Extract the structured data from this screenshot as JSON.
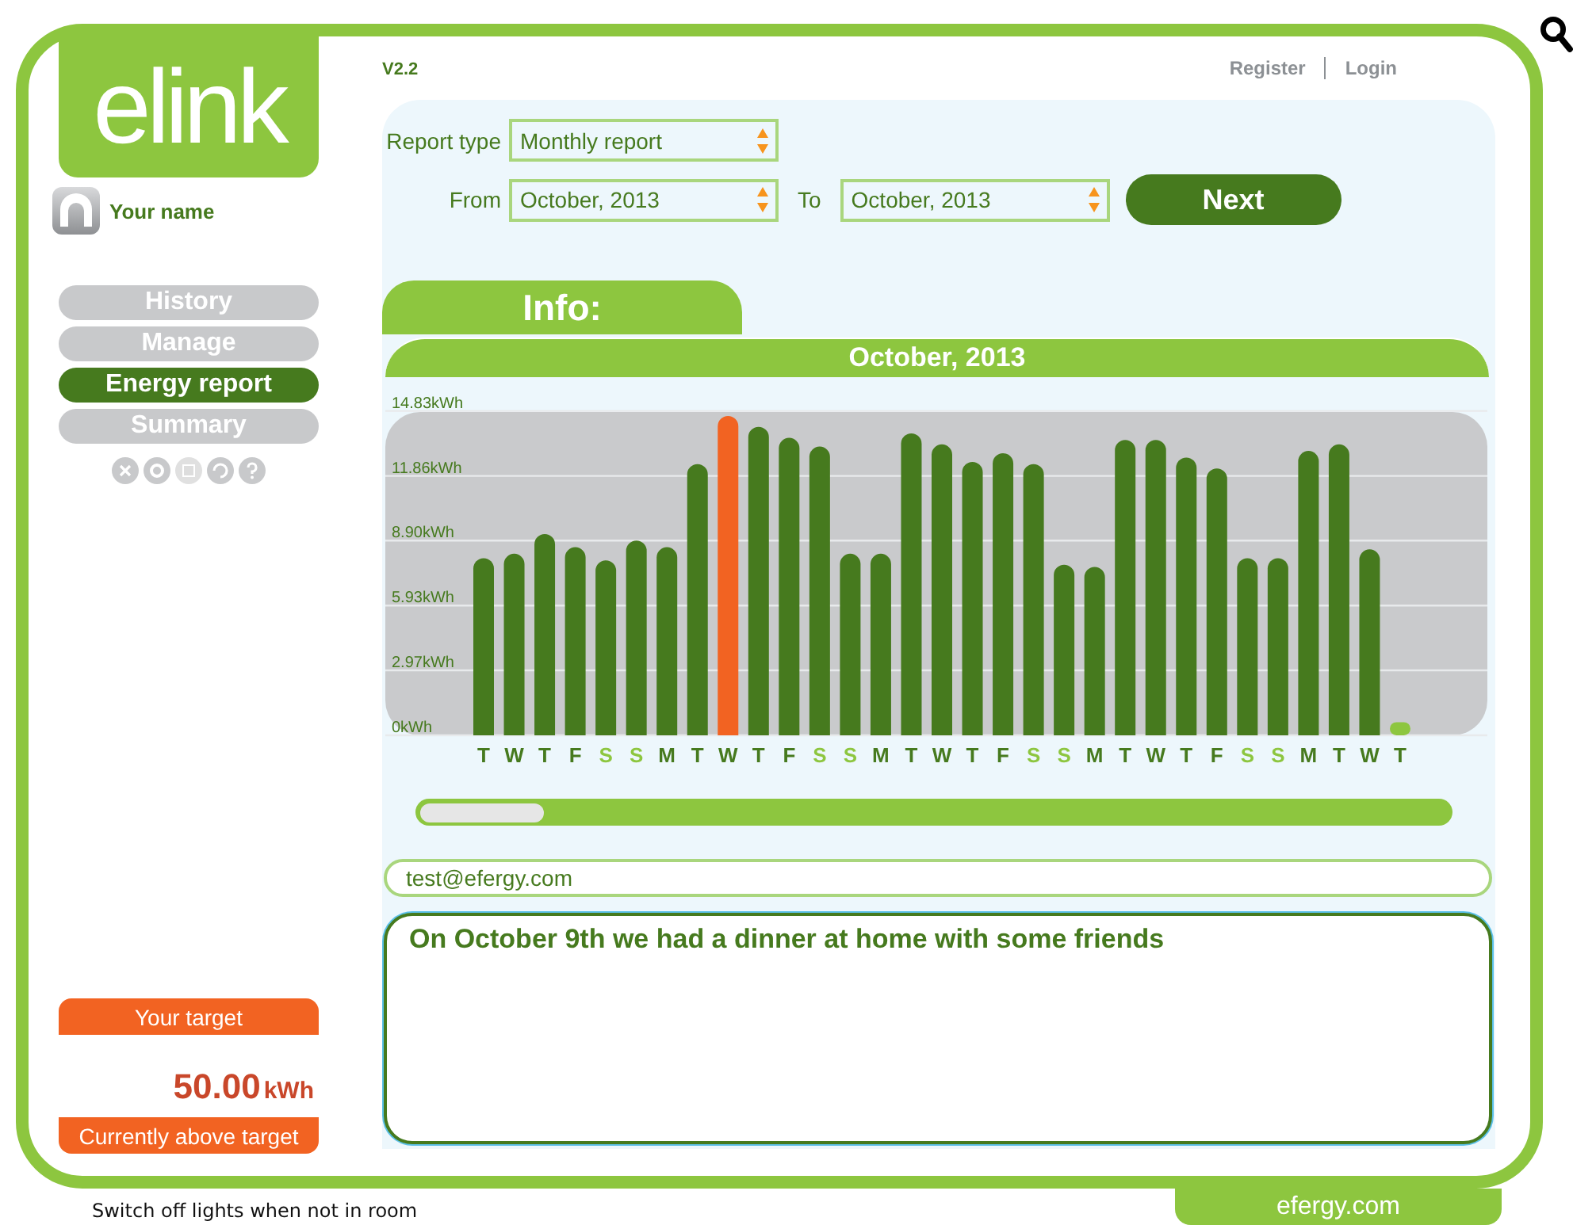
{
  "logo": {
    "text": "elink"
  },
  "user": {
    "name": "Your name"
  },
  "nav": [
    {
      "label": "History",
      "selected": false
    },
    {
      "label": "Manage",
      "selected": false
    },
    {
      "label": "Energy report",
      "selected": true
    },
    {
      "label": "Summary",
      "selected": false
    }
  ],
  "target": {
    "title": "Your target",
    "value": "50.00",
    "unit": "kWh",
    "status": "Currently above target"
  },
  "header": {
    "version": "V2.2",
    "links": [
      "Register",
      "Login"
    ]
  },
  "report_form": {
    "report_type": {
      "label": "Report type",
      "value": "Monthly report"
    },
    "from": {
      "label": "From",
      "value": "October, 2013"
    },
    "to": {
      "label": "To",
      "value": "October, 2013"
    },
    "next_button": "Next"
  },
  "info": {
    "tab": "Info:",
    "period": "October, 2013",
    "chart_data": {
      "type": "bar",
      "categories": [
        "T",
        "W",
        "T",
        "F",
        "S",
        "S",
        "M",
        "T",
        "W",
        "T",
        "F",
        "S",
        "S",
        "M",
        "T",
        "W",
        "T",
        "F",
        "S",
        "S",
        "M",
        "T",
        "W",
        "T",
        "F",
        "S",
        "S",
        "M",
        "T",
        "W",
        "T"
      ],
      "series": [
        {
          "color": "#467a1e",
          "values": [
            8.1,
            8.3,
            9.2,
            8.6,
            8.0,
            8.9,
            8.6,
            12.4,
            null,
            14.1,
            13.6,
            13.2,
            8.3,
            8.3,
            13.8,
            13.3,
            12.5,
            12.9,
            12.4,
            7.8,
            7.7,
            13.5,
            13.5,
            12.7,
            12.2,
            8.1,
            8.1,
            13.0,
            13.3,
            8.5,
            null
          ]
        },
        {
          "color": "#f26322",
          "values": [
            null,
            null,
            null,
            null,
            null,
            null,
            null,
            null,
            14.6,
            null,
            null,
            null,
            null,
            null,
            null,
            null,
            null,
            null,
            null,
            null,
            null,
            null,
            null,
            null,
            null,
            null,
            null,
            null,
            null,
            null,
            null
          ]
        },
        {
          "color": "#8dc63f",
          "values": [
            null,
            null,
            null,
            null,
            null,
            null,
            null,
            null,
            null,
            null,
            null,
            null,
            null,
            null,
            null,
            null,
            null,
            null,
            null,
            null,
            null,
            null,
            null,
            null,
            null,
            null,
            null,
            null,
            null,
            null,
            0.6
          ]
        }
      ],
      "ylim": [
        0,
        14.83
      ],
      "grid": true,
      "yticks": [
        {
          "value": 0,
          "label": "0kWh"
        },
        {
          "value": 2.97,
          "label": "2.97kWh"
        },
        {
          "value": 5.93,
          "label": "5.93kWh"
        },
        {
          "value": 8.9,
          "label": "8.90kWh"
        },
        {
          "value": 11.86,
          "label": "11.86kWh"
        },
        {
          "value": 14.83,
          "label": "14.83kWh"
        }
      ]
    },
    "days": [
      {
        "weekend": false
      },
      {
        "weekend": false
      },
      {
        "weekend": false
      },
      {
        "weekend": false
      },
      {
        "weekend": true
      },
      {
        "weekend": true
      },
      {
        "weekend": false
      },
      {
        "weekend": false
      },
      {
        "weekend": false
      },
      {
        "weekend": false
      },
      {
        "weekend": false
      },
      {
        "weekend": true
      },
      {
        "weekend": true
      },
      {
        "weekend": false
      },
      {
        "weekend": false
      },
      {
        "weekend": false
      },
      {
        "weekend": false
      },
      {
        "weekend": false
      },
      {
        "weekend": true
      },
      {
        "weekend": true
      },
      {
        "weekend": false
      },
      {
        "weekend": false
      },
      {
        "weekend": false
      },
      {
        "weekend": false
      },
      {
        "weekend": false
      },
      {
        "weekend": true
      },
      {
        "weekend": true
      },
      {
        "weekend": false
      },
      {
        "weekend": false
      },
      {
        "weekend": false
      },
      {
        "weekend": false
      }
    ]
  },
  "email": {
    "value": "test@efergy.com"
  },
  "note": {
    "value": "On October 9th we had a dinner at home with some friends"
  },
  "footer": {
    "tip": "Switch off lights when not in room",
    "brand": "efergy.com"
  }
}
